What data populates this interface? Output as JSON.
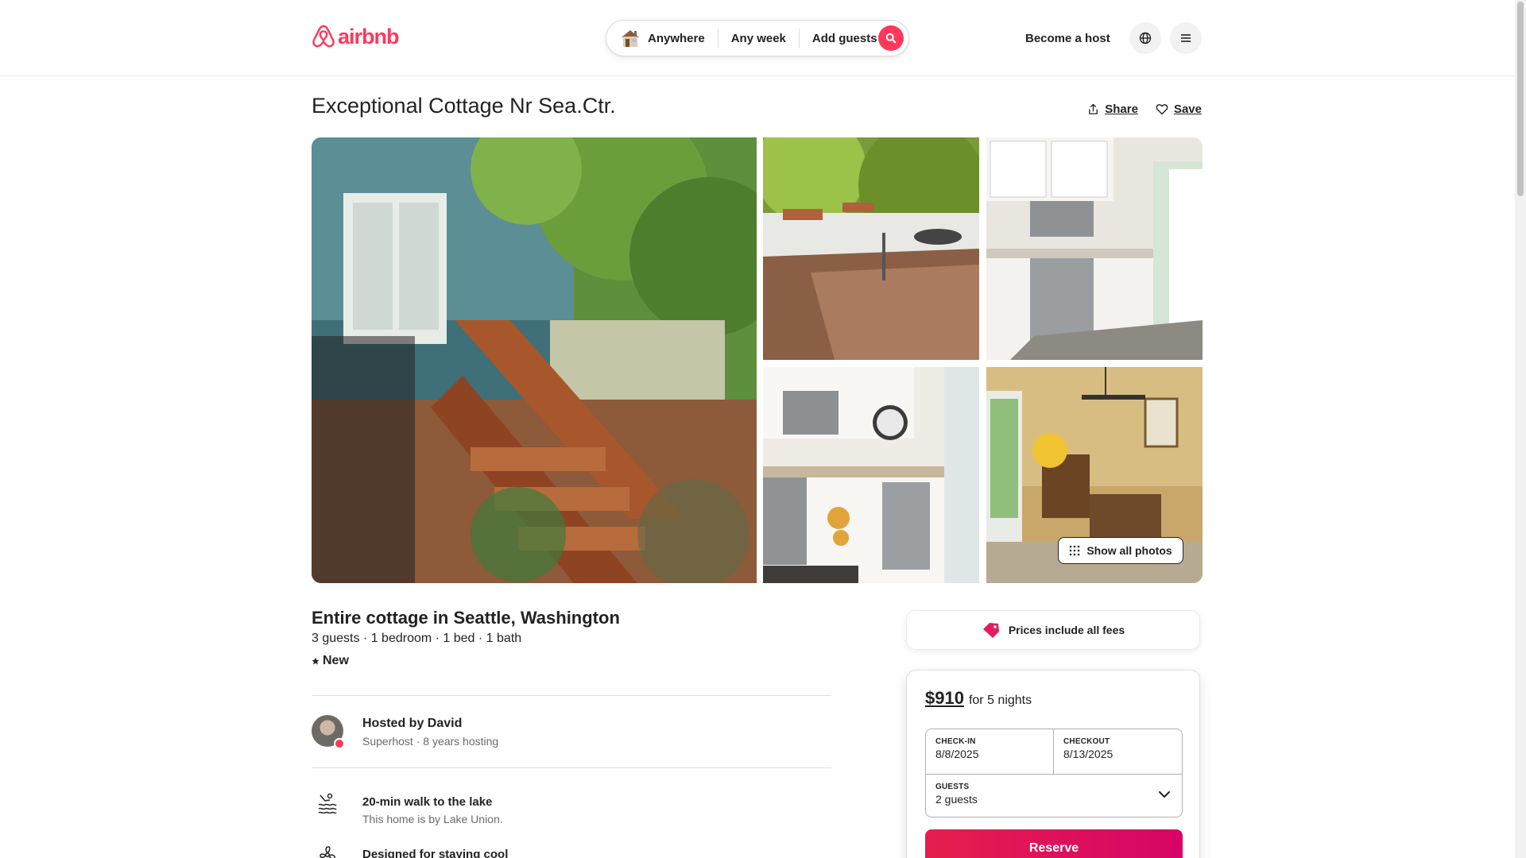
{
  "header": {
    "logo_text": "airbnb",
    "search": {
      "where": "Anywhere",
      "when": "Any week",
      "who": "Add guests"
    },
    "become_host": "Become a host"
  },
  "listing": {
    "title": "Exceptional Cottage Nr Sea.Ctr.",
    "share_label": "Share",
    "save_label": "Save",
    "show_all_photos": "Show all photos",
    "type": "Entire cottage in Seattle, Washington",
    "facts": "3 guests · 1 bedroom · 1 bed · 1 bath",
    "rating_label": "New"
  },
  "host": {
    "name": "Hosted by David",
    "meta": "Superhost · 8 years hosting"
  },
  "highlights": [
    {
      "title": "20-min walk to the lake",
      "subtitle": "This home is by Lake Union."
    },
    {
      "title": "Designed for staying cool",
      "subtitle": ""
    }
  ],
  "fees_banner": "Prices include all fees",
  "booking": {
    "price": "$910",
    "nights": "for 5 nights",
    "checkin_label": "CHECK-IN",
    "checkin_value": "8/8/2025",
    "checkout_label": "CHECKOUT",
    "checkout_value": "8/13/2025",
    "guests_label": "GUESTS",
    "guests_value": "2 guests",
    "reserve_label": "Reserve"
  },
  "colors": {
    "brand": "#ff385c",
    "text": "#222222",
    "muted": "#6a6a6a"
  }
}
